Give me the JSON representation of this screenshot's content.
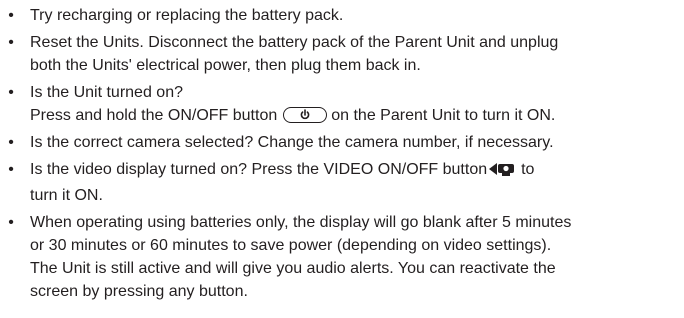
{
  "items": [
    {
      "lines": [
        "Try recharging or replacing the battery pack."
      ]
    },
    {
      "lines": [
        "Reset the Units. Disconnect the battery pack of the Parent Unit and unplug",
        "both the Units' electrical power, then plug them back in."
      ]
    },
    {
      "lines": [
        "Is the Unit turned on?"
      ],
      "line2_pre": "Press and hold the ON/OFF button",
      "line2_post": "on the Parent Unit to turn it ON.",
      "icon": "power-icon"
    },
    {
      "lines": [
        "Is the correct camera selected? Change the camera number, if necessary."
      ]
    },
    {
      "line1_pre": "Is the video display turned on? Press the VIDEO ON/OFF button",
      "line1_post": "to",
      "lines": [
        "turn it ON."
      ],
      "icon": "video-camera-icon"
    },
    {
      "lines": [
        "When operating using batteries only, the display will go blank after 5 minutes",
        "or 30 minutes or 60 minutes to save power (depending on video settings).",
        "The Unit is still active and will give you audio alerts. You can reactivate the",
        "screen by pressing any button."
      ]
    }
  ]
}
